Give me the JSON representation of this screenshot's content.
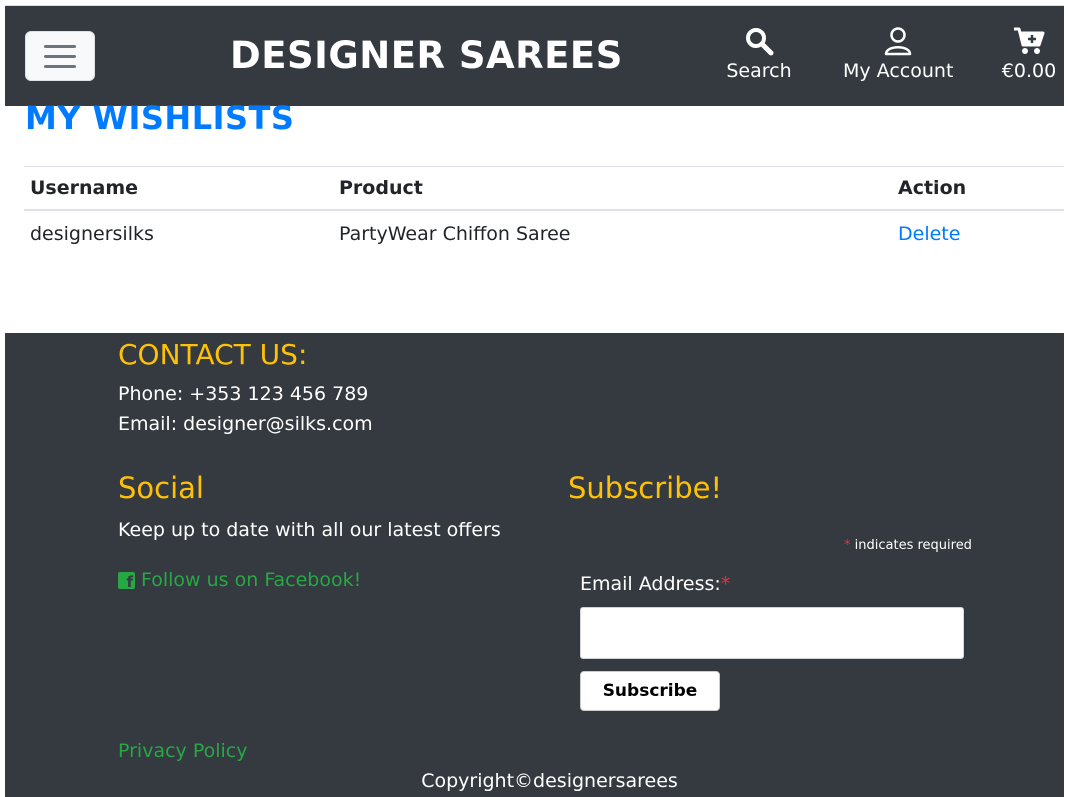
{
  "header": {
    "brand": "DESIGNER SAREES",
    "search_label": "Search",
    "account_label": "My Account",
    "cart_total": "€0.00",
    "icons": [
      "menu-icon",
      "search-icon",
      "user-icon",
      "cart-plus-icon"
    ]
  },
  "main": {
    "title": "MY WISHLISTS",
    "table": {
      "headers": [
        "Username",
        "Product",
        "Action"
      ],
      "rows": [
        {
          "username": "designersilks",
          "product": "PartyWear Chiffon Saree",
          "action": "Delete"
        }
      ]
    }
  },
  "footer": {
    "contact_title": "CONTACT US:",
    "phone": "Phone: +353 123 456 789",
    "email": "Email: designer@silks.com",
    "social_title": "Social",
    "social_text": "Keep up to date with all our latest offers",
    "facebook_link": "Follow us on Facebook!",
    "subscribe_title": "Subscribe!",
    "required_star": "*",
    "required_note": "indicates required",
    "email_label": "Email Address:",
    "email_value": "",
    "subscribe_button": "Subscribe",
    "privacy_link": "Privacy Policy",
    "copyright": "Copyright©designersarees"
  },
  "colors": {
    "dark_bg": "#343a40",
    "accent_blue": "#007bff",
    "footer_heading": "#ffc107",
    "link_green": "#28a745",
    "required_red": "#dc3545"
  }
}
